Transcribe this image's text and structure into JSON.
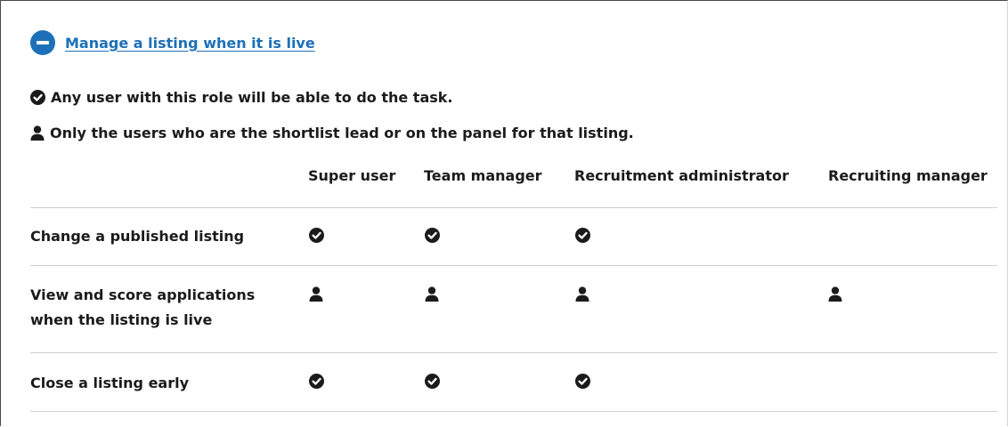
{
  "accordion": {
    "title": "Manage a listing when it is live",
    "toggle_icon": "minus-circle-icon",
    "accent_color": "#1d70b8"
  },
  "key": {
    "any_user_icon": "check-circle-icon",
    "any_user_text": "Any user with this role will be able to do the task.",
    "panel_icon": "person-icon",
    "panel_text": "Only the users who are the shortlist lead or on the panel for that listing."
  },
  "table": {
    "columns": [
      "Super user",
      "Team manager",
      "Recruitment administrator",
      "Recruiting manager"
    ],
    "rows": [
      {
        "task": "Change a published listing",
        "cells": [
          "check",
          "check",
          "check",
          ""
        ]
      },
      {
        "task": "View and score applications when the listing is live",
        "cells": [
          "person",
          "person",
          "person",
          "person"
        ]
      },
      {
        "task": "Close a listing early",
        "cells": [
          "check",
          "check",
          "check",
          ""
        ]
      }
    ]
  }
}
